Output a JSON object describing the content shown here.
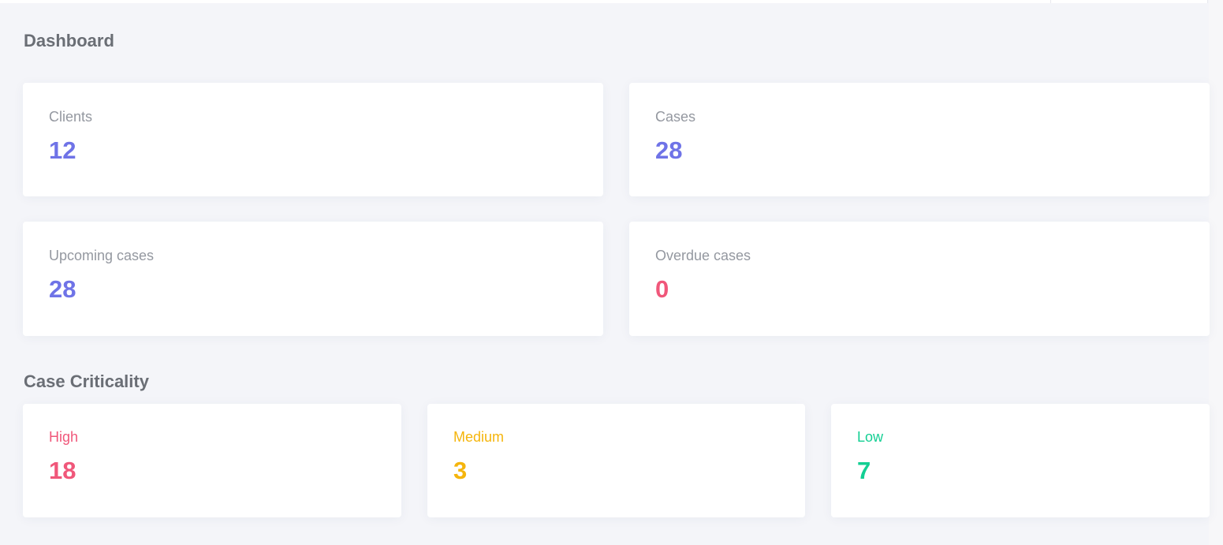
{
  "dashboard": {
    "title": "Dashboard",
    "stats": [
      {
        "label": "Clients",
        "value": "12",
        "color": "#6f73e7"
      },
      {
        "label": "Cases",
        "value": "28",
        "color": "#6f73e7"
      },
      {
        "label": "Upcoming cases",
        "value": "28",
        "color": "#6f73e7"
      },
      {
        "label": "Overdue cases",
        "value": "0",
        "color": "#f0577a"
      }
    ]
  },
  "criticality": {
    "title": "Case Criticality",
    "items": [
      {
        "label": "High",
        "value": "18",
        "color": "#f0577a"
      },
      {
        "label": "Medium",
        "value": "3",
        "color": "#f5b50c"
      },
      {
        "label": "Low",
        "value": "7",
        "color": "#13cf93"
      }
    ]
  }
}
